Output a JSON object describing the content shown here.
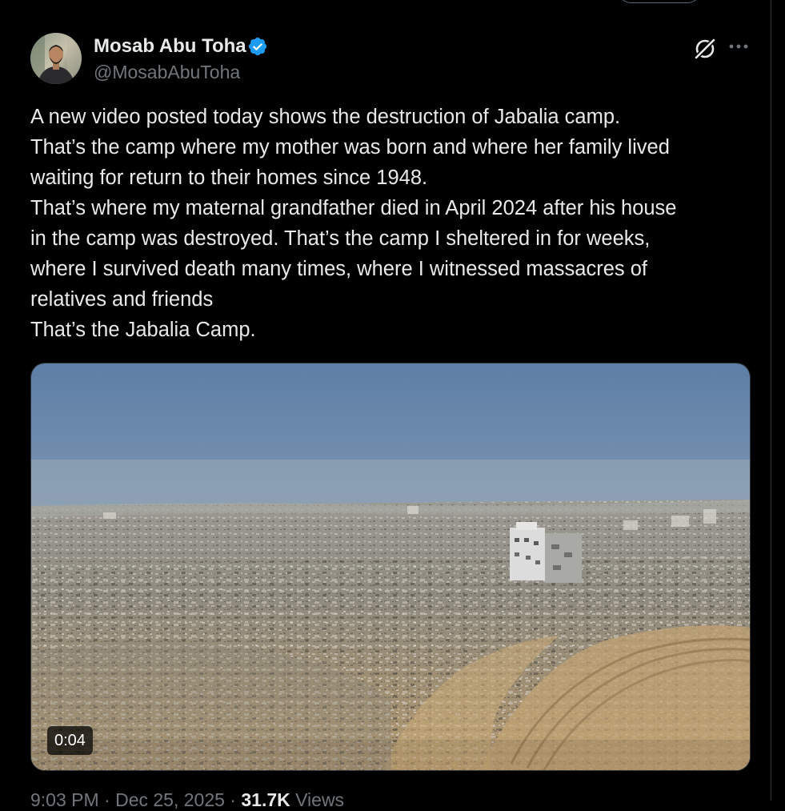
{
  "tweet": {
    "author": {
      "display_name": "Mosab Abu Toha",
      "handle": "@MosabAbuToha",
      "verified": true
    },
    "text_lines": [
      "A new video posted today shows the destruction of Jabalia camp.",
      "That’s the camp where my mother was born and where her family lived",
      "waiting for return to their homes since 1948.",
      "That’s where my maternal grandfather died in April 2024 after his house",
      "in the camp was destroyed. That’s the camp I sheltered in for weeks,",
      "where I survived death many times, where I witnessed massacres of",
      "relatives and friends",
      "That’s the Jabalia Camp."
    ],
    "media": {
      "type": "video",
      "duration": "0:04"
    },
    "meta": {
      "timestamp": "9:03 PM · Dec 25, 2025 · ",
      "views": "31.7K",
      "views_suffix": " Views"
    }
  },
  "icons": {
    "verified": "verified-badge-icon",
    "grok": "grok-icon",
    "more": "more-options-icon"
  },
  "colors": {
    "background": "#000000",
    "text_primary": "#e7e9ea",
    "text_secondary": "#71767b",
    "verified_blue": "#1d9bf0",
    "border": "#2f3336"
  }
}
